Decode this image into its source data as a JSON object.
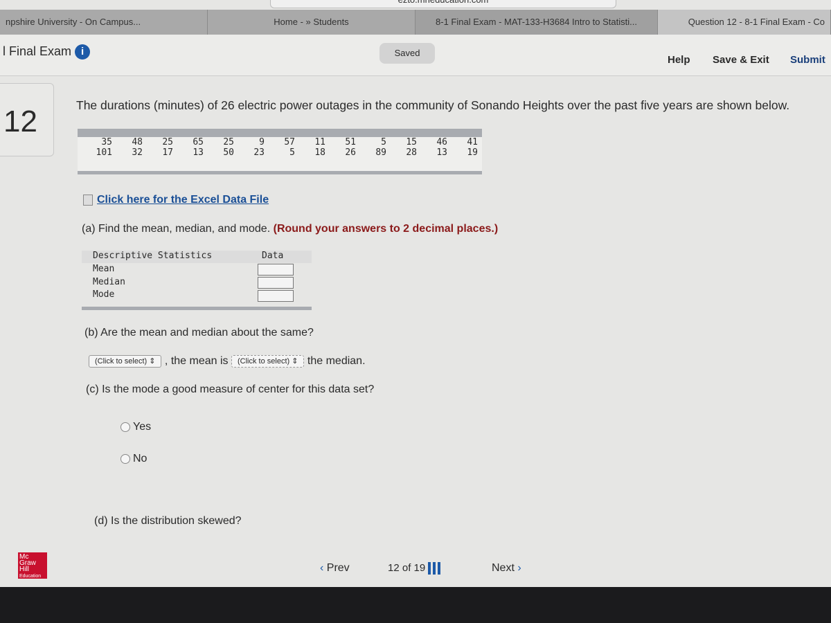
{
  "browser": {
    "url": "ezto.mheducation.com",
    "tabs": [
      "npshire University - On Campus...",
      "Home - » Students",
      "8-1 Final Exam - MAT-133-H3684 Intro to Statisti...",
      "Question 12 - 8-1 Final Exam - Co"
    ]
  },
  "header": {
    "title": "l Final Exam",
    "saved": "Saved",
    "help": "Help",
    "save_exit": "Save & Exit",
    "submit": "Submit"
  },
  "question": {
    "number": "12",
    "prompt": "The durations (minutes) of 26 electric power outages in the community of Sonando Heights over the past five years are shown below.",
    "data_rows": [
      [
        "35",
        "48",
        "25",
        "65",
        "25",
        "9",
        "57",
        "11",
        "51",
        "5",
        "15",
        "46",
        "41"
      ],
      [
        "101",
        "32",
        "17",
        "13",
        "50",
        "23",
        "5",
        "18",
        "26",
        "89",
        "28",
        "13",
        "19"
      ]
    ],
    "excel_link": "Click here for the Excel Data File",
    "part_a": "(a) Find the mean, median, and mode.",
    "part_a_bold": "(Round your answers to 2 decimal places.)",
    "stats_table": {
      "header": "Descriptive Statistics",
      "col": "Data",
      "rows": [
        "Mean",
        "Median",
        "Mode"
      ]
    },
    "part_b": "(b) Are the mean and median about the same?",
    "select1": "(Click to select)",
    "b_text1": ", the mean is",
    "select2": "(Click to select)",
    "b_text2": "the median.",
    "part_c": "(c) Is the mode a good measure of center for this data set?",
    "options": [
      "Yes",
      "No"
    ],
    "part_d": "(d) Is the distribution skewed?"
  },
  "nav": {
    "prev": "Prev",
    "page": "12",
    "of": "of",
    "total": "19",
    "next": "Next"
  },
  "logo": "Mc Graw Hill Education"
}
